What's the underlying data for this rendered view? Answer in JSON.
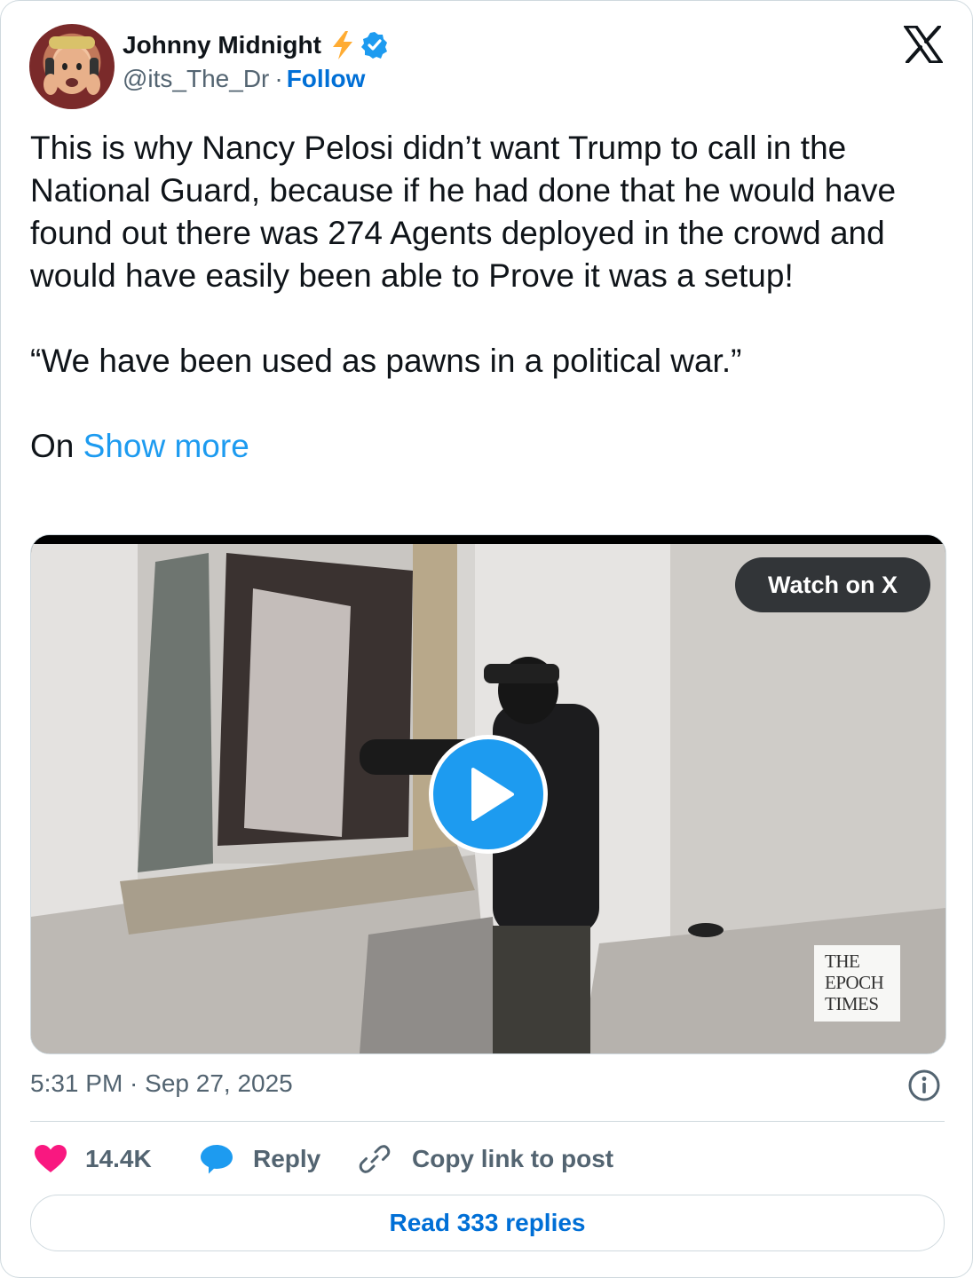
{
  "author": {
    "name": "Johnny Midnight",
    "handle": "@its_The_Dr",
    "separator": "·",
    "follow_label": "Follow"
  },
  "tweet": {
    "text": "This is why Nancy Pelosi didn’t want Trump to call in the National Guard, because if he had done that he would have found out there was 274 Agents deployed in the crowd and would have easily been able to Prove it was a setup!\n\n“We have been used as pawns in a political war.”\n\nOn ",
    "show_more": "Show more"
  },
  "media": {
    "watch_label": "Watch on X",
    "watermark_lines": [
      "THE",
      "EPOCH",
      "TIMES"
    ]
  },
  "timestamp": "5:31 PM · Sep 27, 2025",
  "actions": {
    "likes": "14.4K",
    "reply_label": "Reply",
    "copy_label": "Copy link to post"
  },
  "read_replies_label": "Read 333 replies",
  "colors": {
    "accent": "#1d9bf0",
    "link": "#006fd6",
    "heart": "#f91880",
    "secondary_text": "#536471"
  },
  "icons": [
    "bolt-emoji-icon",
    "verified-badge-icon",
    "x-logo-icon",
    "play-icon",
    "info-icon",
    "heart-icon",
    "reply-bubble-icon",
    "link-icon"
  ]
}
